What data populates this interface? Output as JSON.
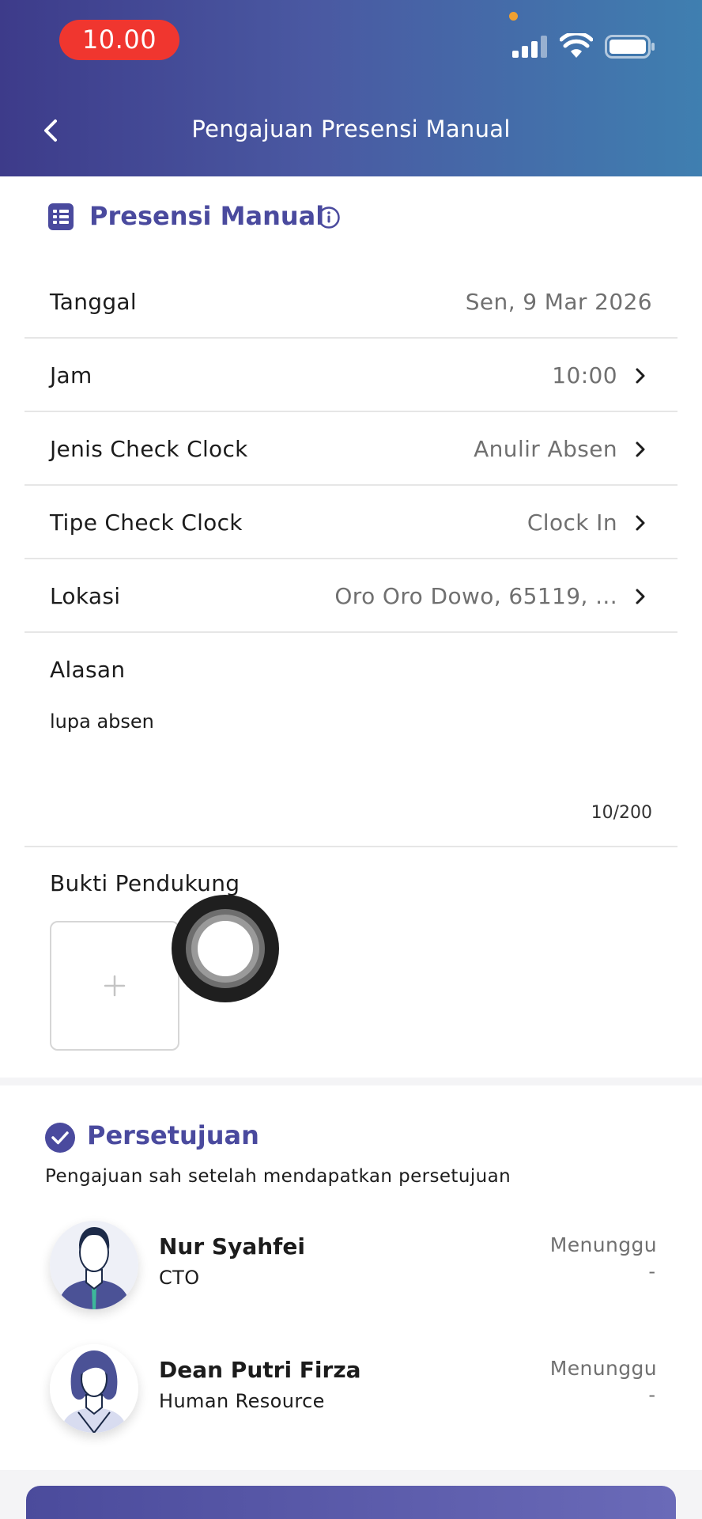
{
  "status_bar": {
    "time": "10.00"
  },
  "header": {
    "title": "Pengajuan Presensi Manual"
  },
  "section": {
    "title": "Presensi Manual"
  },
  "form": {
    "rows": [
      {
        "label": "Tanggal",
        "value": "Sen, 9 Mar 2026"
      },
      {
        "label": "Jam",
        "value": "10:00"
      },
      {
        "label": "Jenis Check Clock",
        "value": "Anulir Absen"
      },
      {
        "label": "Tipe Check Clock",
        "value": "Clock In"
      },
      {
        "label": "Lokasi",
        "value": "Oro Oro Dowo, 65119, ..."
      }
    ],
    "alasan": {
      "label": "Alasan",
      "value": "lupa absen",
      "counter": "10/200"
    },
    "bukti": {
      "label": "Bukti Pendukung"
    }
  },
  "approval": {
    "title": "Persetujuan",
    "subtitle": "Pengajuan sah setelah mendapatkan persetujuan",
    "approvers": [
      {
        "name": "Nur Syahfei",
        "role": "CTO",
        "status": "Menunggu",
        "note": "-"
      },
      {
        "name": "Dean Putri Firza",
        "role": "Human Resource",
        "status": "Menunggu",
        "note": "-"
      }
    ]
  },
  "colors": {
    "accent": "#4a4a9e",
    "status_pill": "#f0362f",
    "header_start": "#3d3b8a",
    "header_end": "#3f7fb0"
  }
}
